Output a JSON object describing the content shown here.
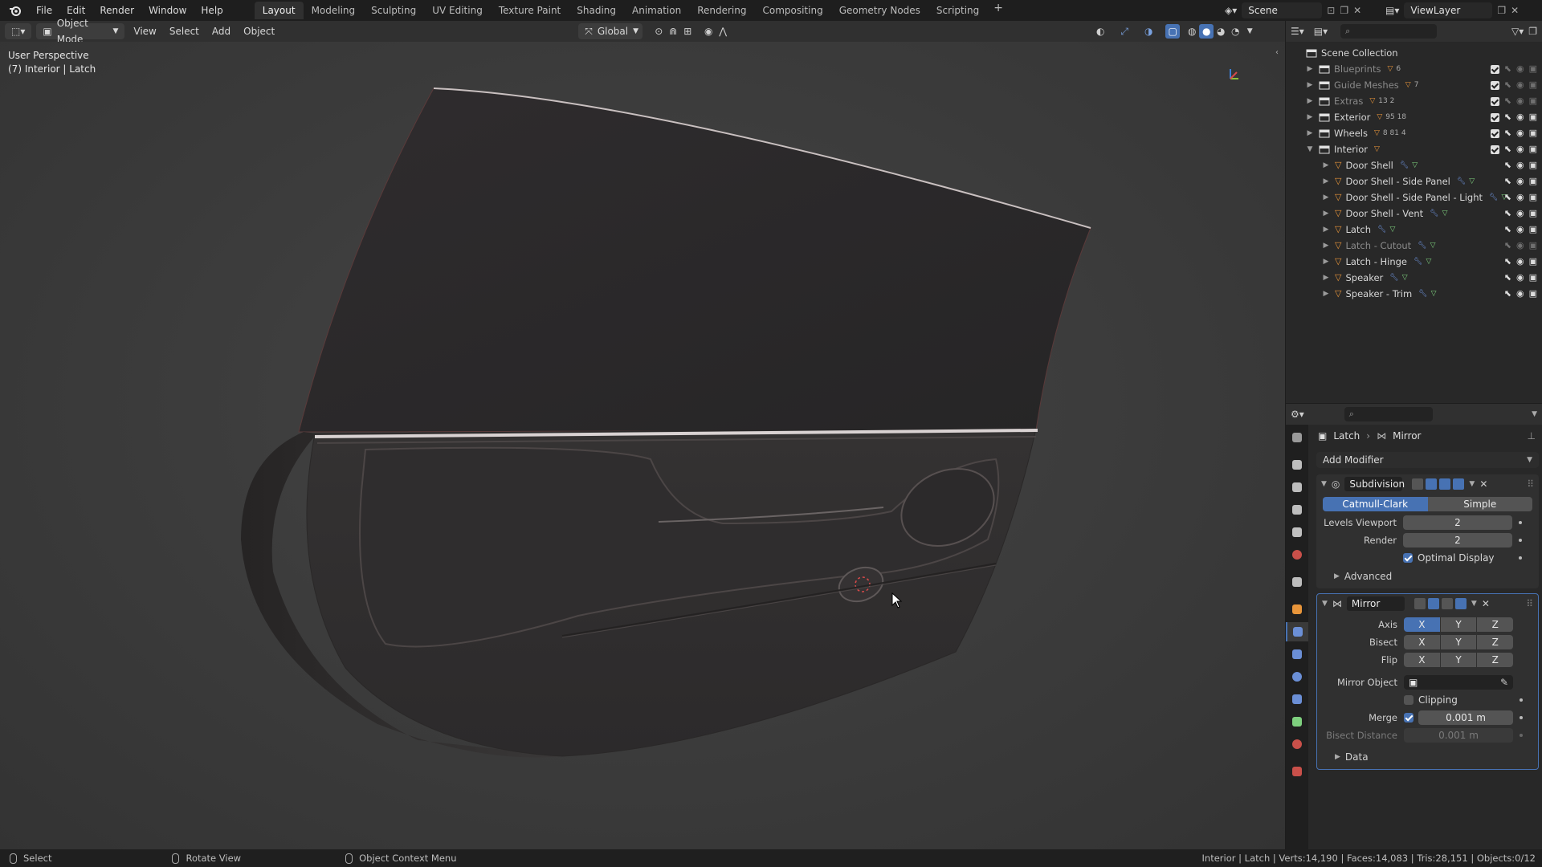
{
  "topbar": {
    "menus": [
      "File",
      "Edit",
      "Render",
      "Window",
      "Help"
    ],
    "workspaces": [
      "Layout",
      "Modeling",
      "Sculpting",
      "UV Editing",
      "Texture Paint",
      "Shading",
      "Animation",
      "Rendering",
      "Compositing",
      "Geometry Nodes",
      "Scripting"
    ],
    "active_workspace": "Layout",
    "scene": "Scene",
    "view_layer": "ViewLayer"
  },
  "viewport_header": {
    "mode": "Object Mode",
    "menus": [
      "View",
      "Select",
      "Add",
      "Object"
    ],
    "transform_orientation": "Global"
  },
  "viewport": {
    "overlay_line1": "User Perspective",
    "overlay_line2": "(7) Interior | Latch"
  },
  "outliner": {
    "root": "Scene Collection",
    "collections": [
      {
        "label": "Blueprints",
        "dim": true,
        "meta": "6"
      },
      {
        "label": "Guide Meshes",
        "dim": true,
        "meta": "7"
      },
      {
        "label": "Extras",
        "dim": true,
        "meta": "13 2"
      },
      {
        "label": "Exterior",
        "dim": false,
        "meta": "95 18"
      },
      {
        "label": "Wheels",
        "dim": false,
        "meta": "8 81 4"
      },
      {
        "label": "Interior",
        "dim": false,
        "meta": ""
      }
    ],
    "objects": [
      {
        "label": "Door Shell",
        "dim": false
      },
      {
        "label": "Door Shell - Side Panel",
        "dim": false
      },
      {
        "label": "Door Shell - Side Panel - Light",
        "dim": false
      },
      {
        "label": "Door Shell - Vent",
        "dim": false
      },
      {
        "label": "Latch",
        "dim": false
      },
      {
        "label": "Latch - Cutout",
        "dim": true
      },
      {
        "label": "Latch - Hinge",
        "dim": false
      },
      {
        "label": "Speaker",
        "dim": false
      },
      {
        "label": "Speaker - Trim",
        "dim": false
      }
    ]
  },
  "properties": {
    "breadcrumb_object": "Latch",
    "breadcrumb_modifier": "Mirror",
    "add_modifier": "Add Modifier",
    "subdivision": {
      "name": "Subdivision",
      "mode_a": "Catmull-Clark",
      "mode_b": "Simple",
      "levels_label": "Levels Viewport",
      "levels_value": "2",
      "render_label": "Render",
      "render_value": "2",
      "optimal_label": "Optimal Display",
      "advanced_label": "Advanced"
    },
    "mirror": {
      "name": "Mirror",
      "axis_label": "Axis",
      "bisect_label": "Bisect",
      "flip_label": "Flip",
      "x": "X",
      "y": "Y",
      "z": "Z",
      "mirror_object_label": "Mirror Object",
      "clipping_label": "Clipping",
      "merge_label": "Merge",
      "merge_value": "0.001 m",
      "bisect_distance_label": "Bisect Distance",
      "bisect_distance_value": "0.001 m",
      "data_label": "Data"
    }
  },
  "statusbar": {
    "select": "Select",
    "rotate": "Rotate View",
    "context": "Object Context Menu",
    "stats": "Interior | Latch | Verts:14,190 | Faces:14,083 | Tris:28,151 | Objects:0/12"
  },
  "colors": {
    "accent": "#4772b3",
    "object_orange": "#e8953a",
    "mesh_green": "#7ed07e",
    "modifier_blue": "#6b8fd6"
  }
}
